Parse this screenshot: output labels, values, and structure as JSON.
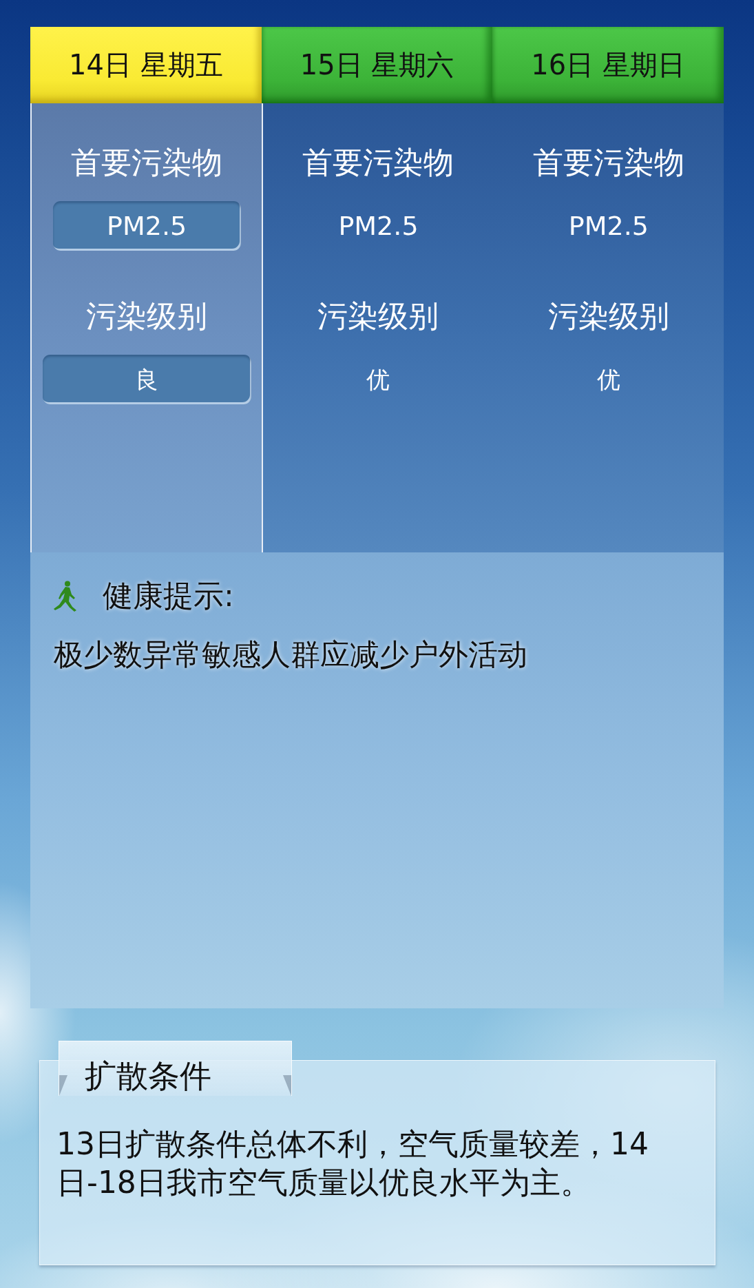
{
  "forecast": {
    "days": [
      {
        "date": "14日 星期五",
        "selected": true,
        "pollutant_label": "首要污染物",
        "pollutant": "PM2.5",
        "grade_label": "污染级别",
        "grade": "良"
      },
      {
        "date": "15日 星期六",
        "selected": false,
        "pollutant_label": "首要污染物",
        "pollutant": "PM2.5",
        "grade_label": "污染级别",
        "grade": "优"
      },
      {
        "date": "16日 星期日",
        "selected": false,
        "pollutant_label": "首要污染物",
        "pollutant": "PM2.5",
        "grade_label": "污染级别",
        "grade": "优"
      }
    ]
  },
  "health_tip": {
    "title": "健康提示:",
    "text": "极少数异常敏感人群应减少户外活动"
  },
  "dispersion": {
    "title": "扩散条件",
    "text": "13日扩散条件总体不利，空气质量较差，14日-18日我市空气质量以优良水平为主。"
  }
}
